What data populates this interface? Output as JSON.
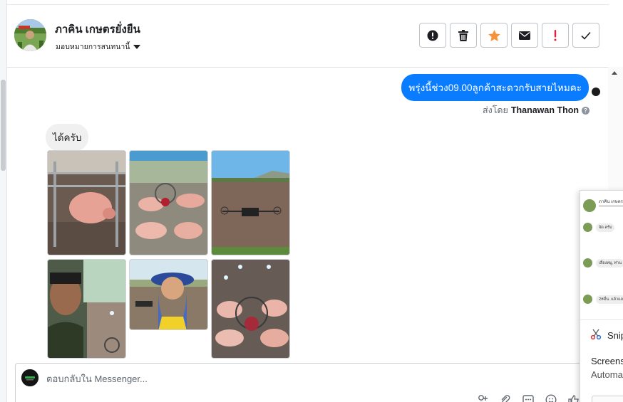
{
  "header": {
    "contact_name": "ภาคิน เกษตรยั่งยืน",
    "assign_label": "มอบหมายการสนทนานี้",
    "actions": [
      {
        "icon": "alert-circle-icon",
        "label": "Mark as spam"
      },
      {
        "icon": "trash-icon",
        "label": "Delete"
      },
      {
        "icon": "star-icon",
        "label": "Star"
      },
      {
        "icon": "envelope-icon",
        "label": "Mark as unread"
      },
      {
        "icon": "exclamation-icon",
        "label": "Follow up"
      },
      {
        "icon": "checkmark-icon",
        "label": "Done"
      }
    ]
  },
  "messages": {
    "outgoing_text": "พรุ่งนี้ช่วง09.00ลูกค้าสะดวกรับสายไหมคะ",
    "sent_by_prefix": "ส่งโดย",
    "sent_by_name": "Thanawan Thon",
    "help_glyph": "?",
    "incoming_text": "ได้ครับ",
    "photos": [
      "pig-in-pen-photo",
      "piglets-feeding-photo",
      "drone-field-photo",
      "farmer-selfie-photo",
      "woman-drone-field-photo",
      "piglets-feeder-photo"
    ]
  },
  "reply": {
    "placeholder": "ตอบกลับใน Messenger..."
  },
  "snip_popup": {
    "preview_name": "ภาคิน เกษตร",
    "preview_bubbles": [
      "จัด ครับ",
      "เลื่องหมู, ท่าน",
      "2หมื่น. แล้วแล"
    ],
    "title": "Snip",
    "message_line1": "Screens",
    "message_line2": "Automa"
  },
  "colors": {
    "accent_blue": "#0a7cff",
    "star_orange": "#f7923a",
    "flag_red": "#e41e3f"
  }
}
